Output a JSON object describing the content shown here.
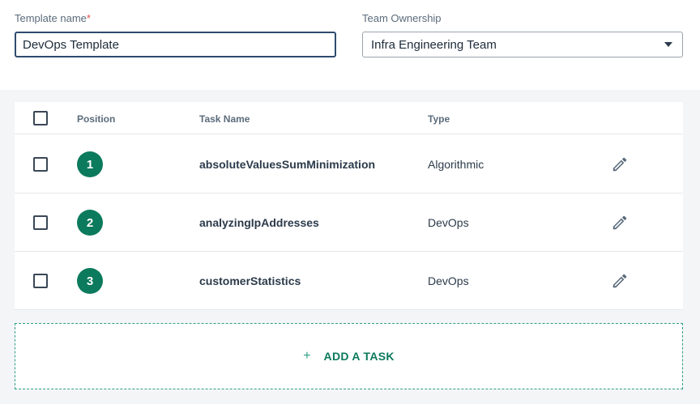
{
  "form": {
    "template_name_label": "Template name",
    "required_mark": "*",
    "template_name_value": "DevOps Template",
    "team_label": "Team Ownership",
    "team_value": "Infra Engineering Team"
  },
  "table": {
    "headers": {
      "position": "Position",
      "task_name": "Task Name",
      "type": "Type"
    },
    "rows": [
      {
        "position": "1",
        "name": "absoluteValuesSumMinimization",
        "type": "Algorithmic"
      },
      {
        "position": "2",
        "name": "analyzingIpAddresses",
        "type": "DevOps"
      },
      {
        "position": "3",
        "name": "customerStatistics",
        "type": "DevOps"
      }
    ]
  },
  "add_task": {
    "icon": "plus-icon",
    "label": "ADD A TASK"
  },
  "icons": {
    "edit": "pencil-icon",
    "dropdown": "chevron-down-icon"
  },
  "colors": {
    "accent": "#0c7a5c",
    "input_border": "#2e4b6d"
  }
}
